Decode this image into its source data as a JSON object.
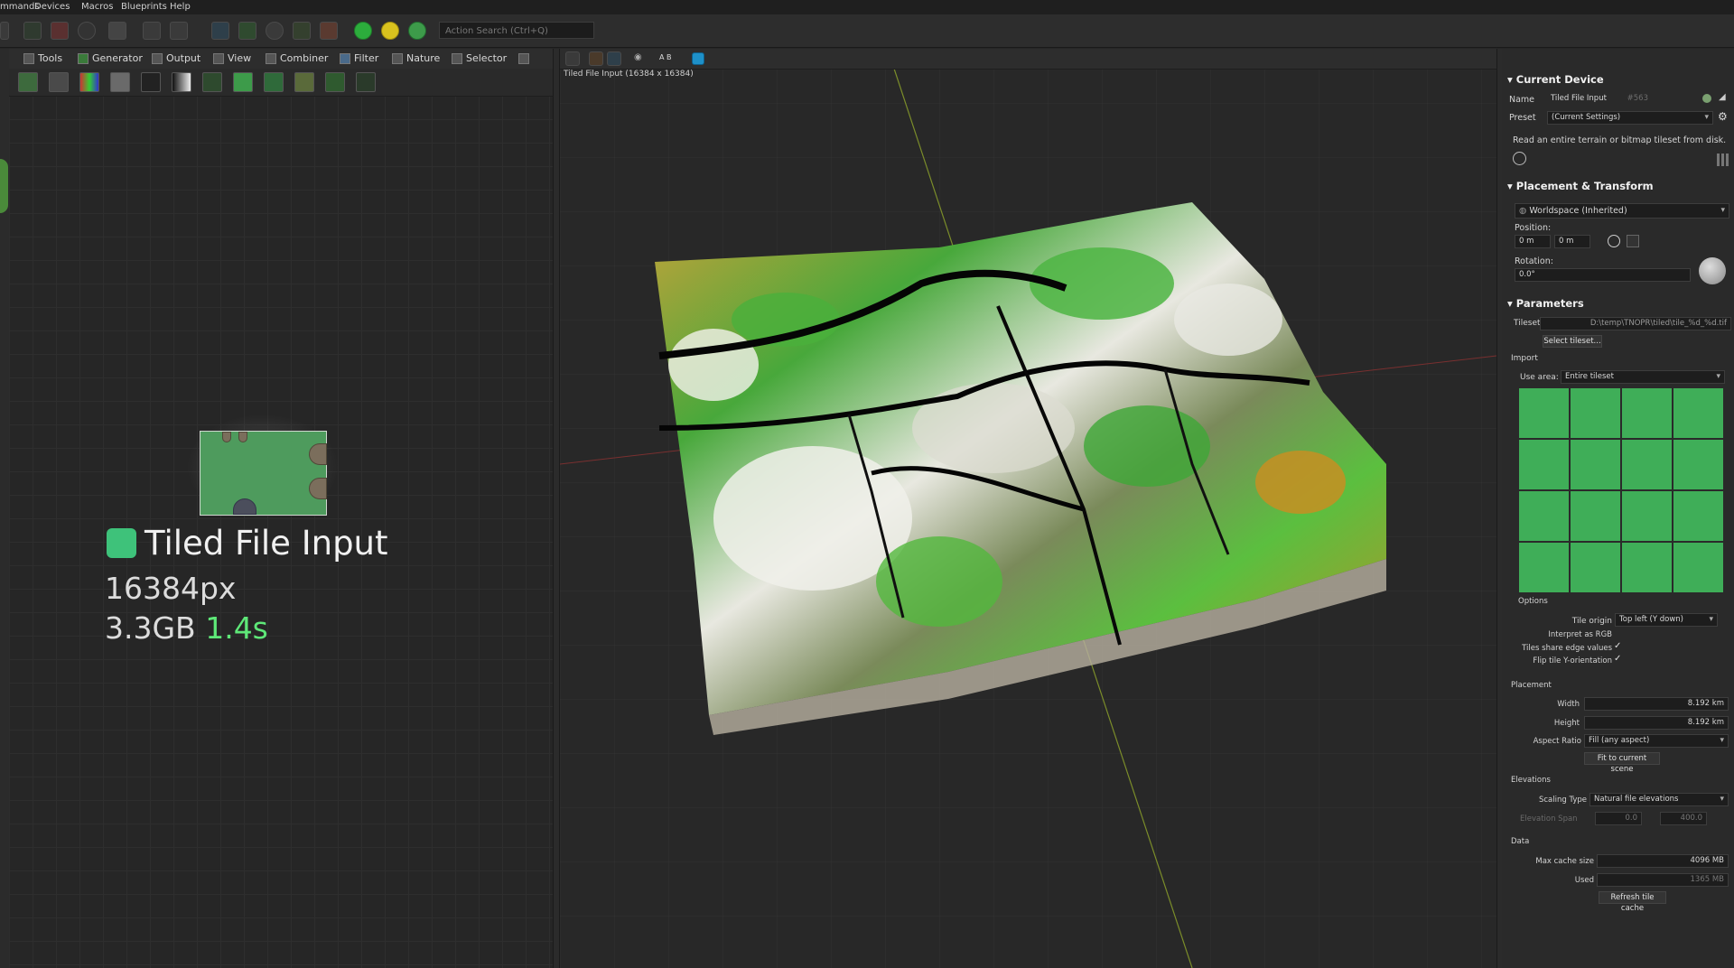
{
  "menu": [
    "mmands",
    "Devices",
    "Macros",
    "Blueprints",
    "Help"
  ],
  "action_search": {
    "placeholder": "Action Search (Ctrl+Q)"
  },
  "tabs": [
    "Tools",
    "Generator",
    "Output",
    "View",
    "Combiner",
    "Filter",
    "Nature",
    "Selector"
  ],
  "node": {
    "title": "Tiled File Input",
    "resolution": "16384px",
    "memory": "3.3GB",
    "time": "1.4s"
  },
  "viewport": {
    "caption": "Tiled File Input (16384 x 16384)",
    "ab_label": "A B"
  },
  "props": {
    "current_device": {
      "title": "Current Device",
      "name_label": "Name",
      "name_value": "Tiled File Input",
      "id": "#563",
      "preset_label": "Preset",
      "preset_value": "(Current Settings)",
      "description": "Read an entire terrain or bitmap tileset from disk."
    },
    "placement_transform": {
      "title": "Placement & Transform",
      "space": "Worldspace (Inherited)",
      "position_label": "Position:",
      "pos_x": "0 m",
      "pos_y": "0 m",
      "rotation_label": "Rotation:",
      "rotation": "0.0°"
    },
    "parameters": {
      "title": "Parameters",
      "tileset_label": "Tileset",
      "tileset_path": "D:\\temp\\TNOPR\\tiled\\tile_%d_%d.tif",
      "select_tileset": "Select tileset...",
      "import_label": "Import",
      "use_area_label": "Use area:",
      "use_area_value": "Entire tileset",
      "options_label": "Options",
      "tile_origin_label": "Tile origin",
      "tile_origin_value": "Top left (Y down)",
      "interpret_rgb": "Interpret as RGB",
      "share_edge": "Tiles share edge values",
      "share_edge_check": "✓",
      "flip_y": "Flip tile Y-orientation",
      "flip_y_check": "✓",
      "placement_label": "Placement",
      "width_label": "Width",
      "width_value": "8.192 km",
      "height_label": "Height",
      "height_value": "8.192 km",
      "aspect_label": "Aspect Ratio",
      "aspect_value": "Fill (any aspect)",
      "fit_scene": "Fit to current scene",
      "elevations_label": "Elevations",
      "scaling_label": "Scaling Type",
      "scaling_value": "Natural file elevations",
      "elev_span_label": "Elevation Span",
      "elev_min": "0.0",
      "elev_max": "400.0",
      "data_label": "Data",
      "max_cache_label": "Max cache size",
      "max_cache_value": "4096 MB",
      "used_label": "Used",
      "used_value": "1365 MB",
      "refresh_cache": "Refresh tile cache"
    }
  },
  "colors": {
    "accent_green": "#3ec27a",
    "time_green": "#5ee878",
    "tile_green": "#3fae58"
  }
}
